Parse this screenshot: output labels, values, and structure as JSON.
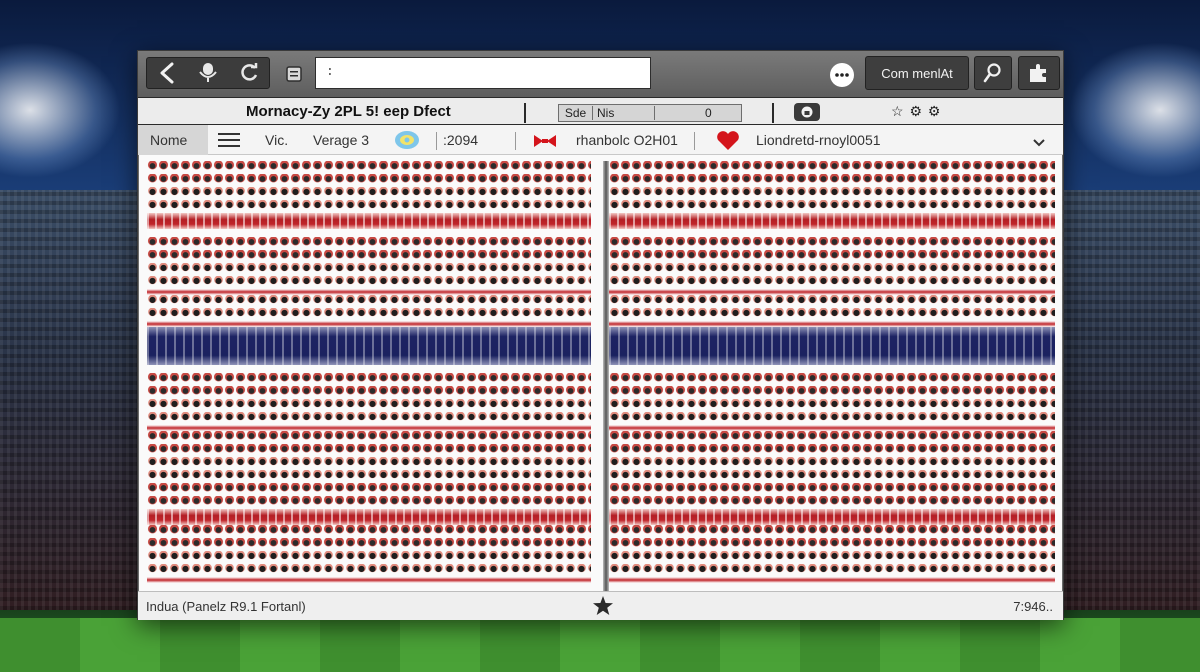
{
  "toolbar": {
    "address_value": ":",
    "comment_label": "Com menlAt"
  },
  "titlebar": {
    "title": "Mornacy-Zy 2PL 5! eep Dfect",
    "status_a": "Sde",
    "status_b": "Nis",
    "status_c": "0",
    "icons_text": "☆ ⚙ ⚙"
  },
  "filterbar": {
    "name_label": "Nome",
    "item_vic": "Vic.",
    "item_verage": "Verage 3",
    "item_code": ":2094",
    "item_rhanbolc": "rhanbolc O2H01",
    "item_liondretd": "Liondretd-rnoyl0051"
  },
  "statusbar": {
    "left_text": "Indua (Panelz R9.1 Fortanl)",
    "right_text": "7:946.."
  },
  "colors": {
    "accent_red": "#c0252b",
    "accent_navy": "#1b2260",
    "heart": "#d4141b"
  }
}
